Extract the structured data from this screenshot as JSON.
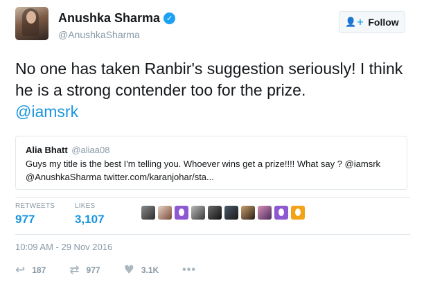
{
  "tweet": {
    "author_name": "Anushka Sharma",
    "author_handle": "@AnushkaSharma",
    "follow_label": "Follow",
    "text": "No one has taken Ranbir's suggestion seriously! I think he is a strong contender too for the prize.",
    "mention": "@iamsrk",
    "quoted": {
      "name": "Alia Bhatt",
      "handle": "@aliaa08",
      "text": "Guys my title is the best I'm telling you. Whoever wins get a prize!!!! What say ? @iamsrk @AnushkaSharma twitter.com/karanjohar/sta..."
    },
    "stats": {
      "retweets_label": "RETWEETS",
      "retweets": "977",
      "likes_label": "LIKES",
      "likes": "3,107"
    },
    "timestamp": "10:09 AM - 29 Nov 2016",
    "actions": {
      "reply_count": "187",
      "retweet_count": "977",
      "like_count": "3.1K"
    }
  },
  "icons": {
    "verified": "verified-badge-icon",
    "follow": "add-user-icon",
    "reply": "reply-icon",
    "retweet": "retweet-icon",
    "like": "heart-icon",
    "more": "more-dots-icon"
  },
  "colors": {
    "accent": "#1da1f2",
    "link": "#1b95e0",
    "muted": "#8899a6",
    "egg_purple": "#8d58d1",
    "egg_orange": "#f4a316"
  }
}
